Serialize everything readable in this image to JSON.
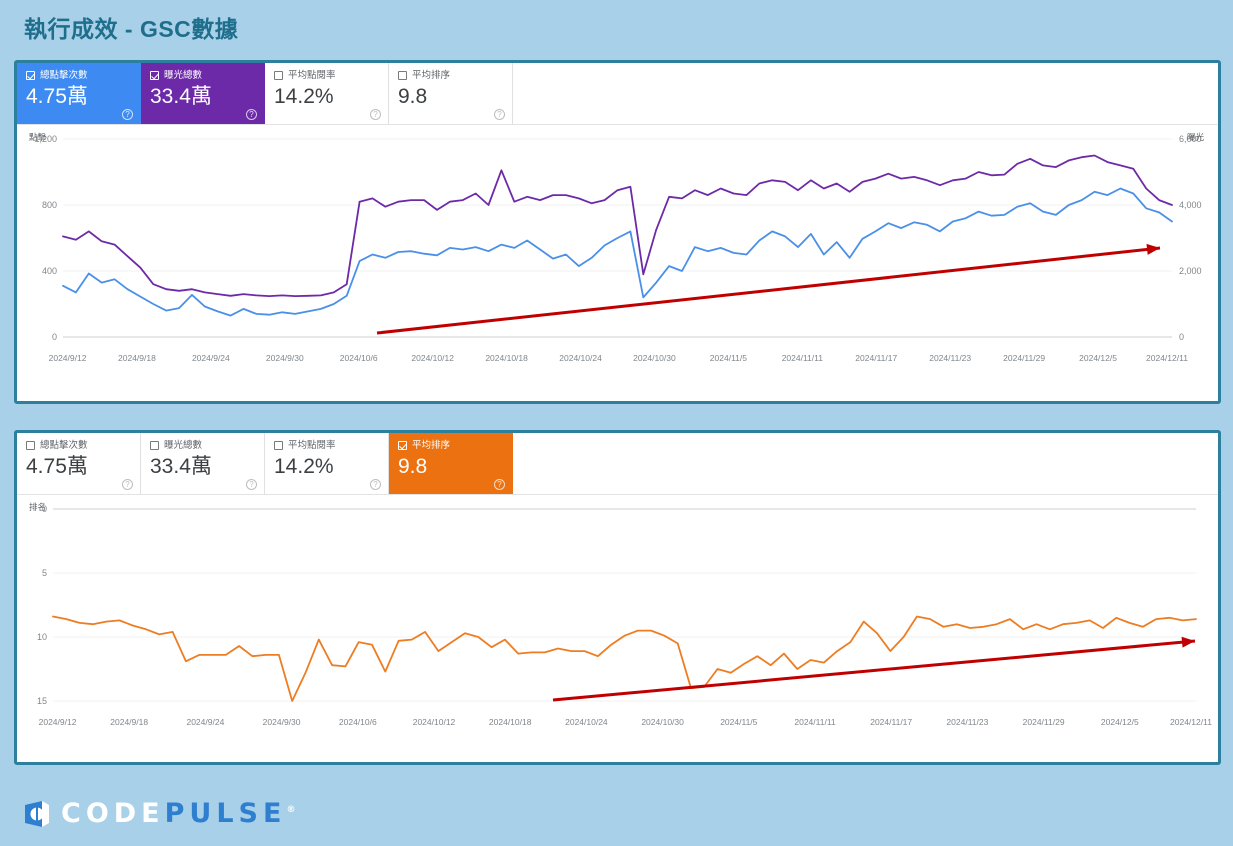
{
  "page": {
    "title": "執行成效 - GSC數據",
    "title_color": "#1f6e8c",
    "background_color": "#a8d0e8",
    "panel_border_color": "#2d7f9e"
  },
  "logo": {
    "part1": "CODE",
    "part2": "PULSE",
    "registered": "®"
  },
  "metrics": {
    "clicks": {
      "label": "總點擊次數",
      "value": "4.75萬",
      "color": "#3d8bf2"
    },
    "impressions": {
      "label": "曝光總數",
      "value": "33.4萬",
      "color": "#6d2aa8"
    },
    "ctr": {
      "label": "平均點閱率",
      "value": "14.2%",
      "color": "#5f6368"
    },
    "position": {
      "label": "平均排序",
      "value": "9.8",
      "color": "#ec7211"
    }
  },
  "panel1": {
    "cards": [
      {
        "label": "總點擊次數",
        "value": "4.75萬",
        "checked": true,
        "state": "sel-blue",
        "help": "?"
      },
      {
        "label": "曝光總數",
        "value": "33.4萬",
        "checked": true,
        "state": "sel-purple",
        "help": "?"
      },
      {
        "label": "平均點閱率",
        "value": "14.2%",
        "checked": false,
        "state": "plain",
        "help": "?"
      },
      {
        "label": "平均排序",
        "value": "9.8",
        "checked": false,
        "state": "plain",
        "help": "?"
      }
    ]
  },
  "panel2": {
    "cards": [
      {
        "label": "總點擊次數",
        "value": "4.75萬",
        "checked": false,
        "state": "plain",
        "help": "?"
      },
      {
        "label": "曝光總數",
        "value": "33.4萬",
        "checked": false,
        "state": "plain",
        "help": "?"
      },
      {
        "label": "平均點閱率",
        "value": "14.2%",
        "checked": false,
        "state": "plain",
        "help": "?"
      },
      {
        "label": "平均排序",
        "value": "9.8",
        "checked": true,
        "state": "sel-orange",
        "help": "?"
      }
    ]
  },
  "chart_data": [
    {
      "id": "gsc-clicks-impressions",
      "type": "line",
      "title": "",
      "xlabel": "",
      "ylabel": "點擊",
      "y2label": "曝光",
      "grid": true,
      "legend": "none",
      "yticks": [
        0,
        400,
        800,
        1200
      ],
      "ytick_labels": [
        "0",
        "400",
        "800",
        "1,200"
      ],
      "ylim": [
        0,
        1200
      ],
      "y2ticks": [
        0,
        2000,
        4000,
        6000
      ],
      "y2tick_labels": [
        "0",
        "2,000",
        "4,000",
        "6,000"
      ],
      "y2lim": [
        0,
        6000
      ],
      "xtick_labels": [
        "2024/9/12",
        "2024/9/18",
        "2024/9/24",
        "2024/9/30",
        "2024/10/6",
        "2024/10/12",
        "2024/10/18",
        "2024/10/24",
        "2024/10/30",
        "2024/11/5",
        "2024/11/11",
        "2024/11/17",
        "2024/11/23",
        "2024/11/29",
        "2024/12/5",
        "2024/12/11"
      ],
      "annotation": {
        "type": "trend-arrow",
        "color": "#c00000",
        "direction": "up-right"
      },
      "series": [
        {
          "name": "點擊",
          "color": "#4a90e8",
          "axis": "left",
          "values": [
            310,
            270,
            385,
            330,
            350,
            290,
            245,
            200,
            160,
            175,
            255,
            185,
            155,
            130,
            170,
            140,
            135,
            150,
            140,
            155,
            170,
            200,
            250,
            460,
            500,
            480,
            515,
            520,
            505,
            495,
            540,
            530,
            545,
            520,
            560,
            540,
            585,
            530,
            475,
            500,
            430,
            480,
            555,
            600,
            640,
            240,
            330,
            430,
            400,
            545,
            520,
            540,
            510,
            500,
            585,
            640,
            610,
            545,
            625,
            500,
            575,
            480,
            595,
            640,
            690,
            660,
            695,
            680,
            640,
            700,
            720,
            760,
            735,
            740,
            790,
            810,
            760,
            740,
            800,
            830,
            880,
            860,
            900,
            870,
            780,
            755,
            700
          ]
        },
        {
          "name": "曝光",
          "color": "#6d2aa8",
          "axis": "right",
          "values": [
            3050,
            2950,
            3200,
            2900,
            2800,
            2450,
            2100,
            1600,
            1450,
            1400,
            1450,
            1350,
            1300,
            1250,
            1300,
            1260,
            1240,
            1260,
            1240,
            1250,
            1260,
            1350,
            1600,
            4100,
            4200,
            3950,
            4100,
            4150,
            4150,
            3850,
            4100,
            4150,
            4350,
            4000,
            5050,
            4100,
            4250,
            4150,
            4300,
            4300,
            4200,
            4050,
            4150,
            4450,
            4550,
            1900,
            3250,
            4250,
            4200,
            4450,
            4300,
            4500,
            4350,
            4300,
            4650,
            4750,
            4700,
            4450,
            4750,
            4500,
            4650,
            4400,
            4700,
            4800,
            4950,
            4800,
            4850,
            4750,
            4600,
            4750,
            4800,
            5000,
            4900,
            4920,
            5250,
            5400,
            5200,
            5150,
            5350,
            5450,
            5500,
            5300,
            5200,
            5100,
            4500,
            4150,
            4000
          ]
        }
      ]
    },
    {
      "id": "gsc-average-position",
      "type": "line",
      "title": "",
      "xlabel": "",
      "ylabel": "排名",
      "grid": true,
      "legend": "none",
      "yticks": [
        0,
        5,
        10,
        15
      ],
      "ytick_labels": [
        "0",
        "5",
        "10",
        "15"
      ],
      "ylim": [
        0,
        15
      ],
      "y_inverted": true,
      "xtick_labels": [
        "2024/9/12",
        "2024/9/18",
        "2024/9/24",
        "2024/9/30",
        "2024/10/6",
        "2024/10/12",
        "2024/10/18",
        "2024/10/24",
        "2024/10/30",
        "2024/11/5",
        "2024/11/11",
        "2024/11/17",
        "2024/11/23",
        "2024/11/29",
        "2024/12/5",
        "2024/12/11"
      ],
      "annotation": {
        "type": "trend-arrow",
        "color": "#c00000",
        "direction": "up-right"
      },
      "series": [
        {
          "name": "排名",
          "color": "#ed7d22",
          "axis": "left",
          "values": [
            8.4,
            8.6,
            8.9,
            9.0,
            8.8,
            8.7,
            9.1,
            9.4,
            9.8,
            9.6,
            11.9,
            11.4,
            11.4,
            11.4,
            10.7,
            11.5,
            11.4,
            11.4,
            15.0,
            12.8,
            10.2,
            12.2,
            12.3,
            10.4,
            10.6,
            12.7,
            10.3,
            10.2,
            9.6,
            11.1,
            10.4,
            9.7,
            10.0,
            10.8,
            10.2,
            11.3,
            11.2,
            11.2,
            10.9,
            11.1,
            11.1,
            11.5,
            10.6,
            9.9,
            9.5,
            9.5,
            9.9,
            10.5,
            14.0,
            13.9,
            12.5,
            12.8,
            12.1,
            11.5,
            12.2,
            11.3,
            12.5,
            11.8,
            12.0,
            11.1,
            10.4,
            8.8,
            9.7,
            11.1,
            10.0,
            8.4,
            8.6,
            9.2,
            9.0,
            9.3,
            9.2,
            9.0,
            8.6,
            9.4,
            9.0,
            9.4,
            9.0,
            8.9,
            8.7,
            9.3,
            8.5,
            8.9,
            9.2,
            8.6,
            8.5,
            8.7,
            8.6
          ]
        }
      ]
    }
  ]
}
